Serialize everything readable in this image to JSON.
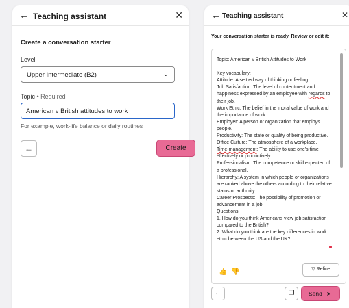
{
  "left": {
    "title": "Teaching assistant",
    "back_icon": "←",
    "close_icon": "✕",
    "heading": "Create a conversation starter",
    "level_label": "Level",
    "level_value": "Upper Intermediate (B2)",
    "chevron": "⌄",
    "topic_label": "Topic",
    "topic_required": " • Required",
    "topic_value": "American v British attitudes to work",
    "example_prefix": "For example, ",
    "example_1": "work-life balance",
    "example_or": " or ",
    "example_2": "daily routines",
    "back_button_icon": "←",
    "create_label": "Create"
  },
  "right": {
    "title": "Teaching assistant",
    "back_icon": "←",
    "close_icon": "✕",
    "ready_text": "Your conversation starter is ready. Review or edit it:",
    "lines": {
      "l1": "Topic: American v British Attitudes to Work",
      "l2": "Key vocabulary:",
      "l3": "Attitude: A settled way of thinking or feeling.",
      "l4a": "Job Satisfaction: The level of contentment and happiness expressed by an employee with ",
      "l4b": "regards",
      "l4c": " to their job.",
      "l5": "Work Ethic: The belief in the moral value of work and the importance of work.",
      "l6": "Employer: A person or organization that employs people.",
      "l7": "Productivity: The state or quality of being productive.",
      "l8": "Office Culture: The atmosphere of a workplace.",
      "l9a": "Time-management",
      "l9b": ": The ability to use one's time effectively or productively.",
      "l10": "Professionalism: The competence or skill expected of a professional.",
      "l11": "Hierarchy: A system in which people or organizations are ranked above the others according to their relative status or authority.",
      "l12": "Career Prospects: The possibility of promotion or advancement in a job.",
      "l13": "Questions:",
      "l14": "1. How do you think Americans view job satisfaction compared to the British?",
      "l15": "2. What do you think are the key differences in work ethic between the US and the UK?"
    },
    "thumb_up_icon": "👍",
    "thumb_down_icon": "👎",
    "refine_icon": "▽",
    "refine_label": "Refine",
    "copy_icon": "❐",
    "back_button_icon": "←",
    "send_label": "Send",
    "send_icon": "➤"
  },
  "colors": {
    "accent": "#e86a95",
    "focus": "#2a66c9"
  }
}
